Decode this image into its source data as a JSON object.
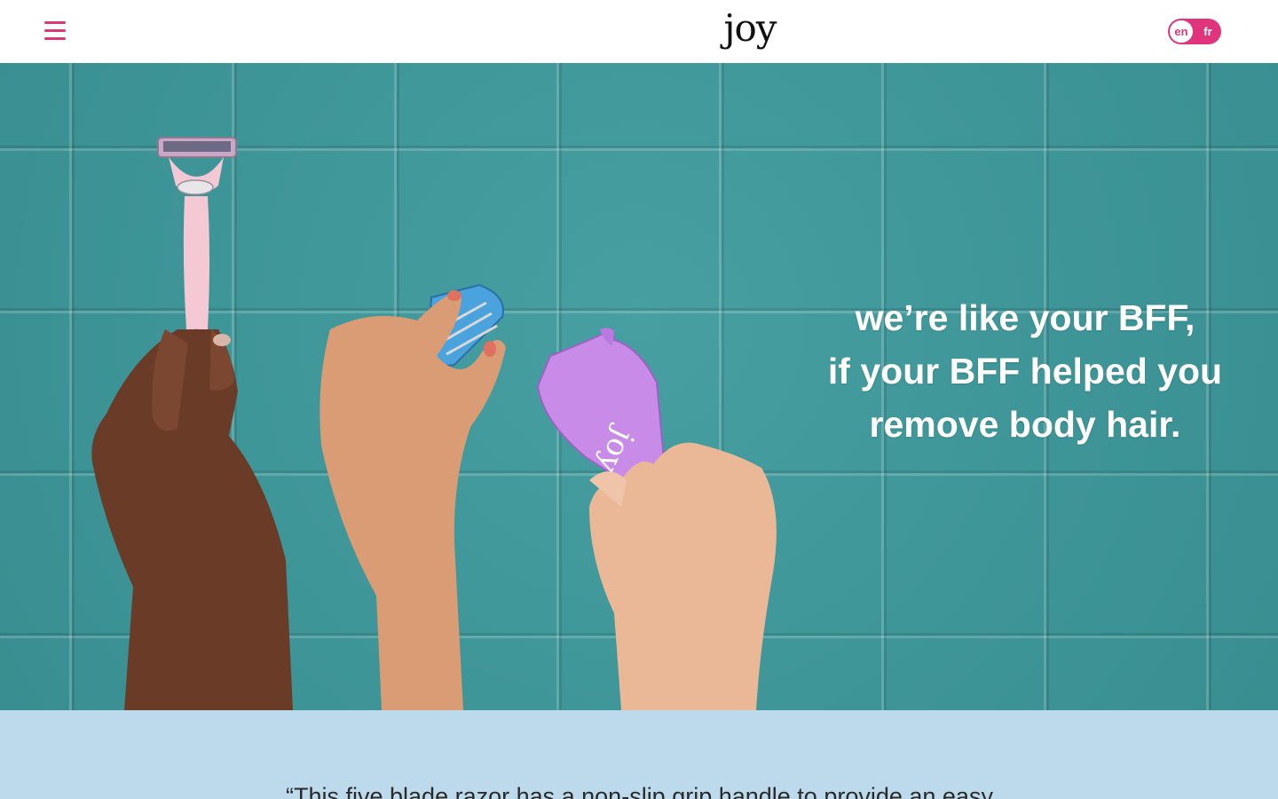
{
  "header": {
    "menu_icon": "hamburger-menu-icon",
    "logo": "joy",
    "language": {
      "options": [
        "en",
        "fr"
      ],
      "selected": "en"
    },
    "colors": {
      "accent": "#e0357c",
      "menu": "#d63a7a"
    }
  },
  "hero": {
    "headline": [
      "we’re like your BFF,",
      "if your BFF helped you",
      "remove body hair."
    ],
    "background_color": "#3d9a9c",
    "products": [
      "razor-handle",
      "blade-cartridge",
      "razor-holder"
    ]
  },
  "quote_section": {
    "text": "“This five blade razor has a non-slip grip handle to provide an easy",
    "background_color": "#bcdaeb"
  }
}
